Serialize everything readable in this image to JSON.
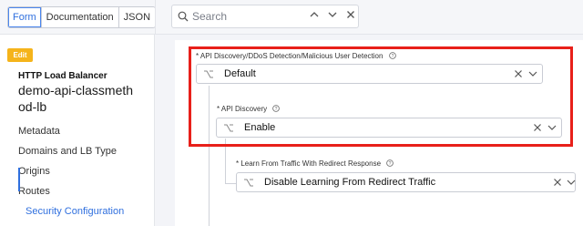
{
  "tabs": [
    {
      "label": "Form",
      "active": true
    },
    {
      "label": "Documentation",
      "active": false
    },
    {
      "label": "JSON",
      "active": false
    }
  ],
  "search": {
    "placeholder": "Search"
  },
  "left": {
    "badge": "Edit",
    "type": "HTTP Load Balancer",
    "name": "demo-api-classmeth od-lb",
    "nav": [
      {
        "label": "Metadata",
        "active": false
      },
      {
        "label": "Domains and LB Type",
        "active": false
      },
      {
        "label": "Origins",
        "active": false
      },
      {
        "label": "Routes",
        "active": false
      },
      {
        "label": "Security Configuration",
        "active": true
      }
    ]
  },
  "fields": [
    {
      "label": "* API Discovery/DDoS Detection/Malicious User Detection",
      "value": "Default"
    },
    {
      "label": "* API Discovery",
      "value": "Enable"
    },
    {
      "label": "* Learn From Traffic With Redirect Response",
      "value": "Disable Learning From Redirect Traffic"
    }
  ],
  "icons": {
    "search": "search-icon",
    "up": "chevron-up-icon",
    "down": "chevron-down-icon",
    "close": "close-icon",
    "help": "help-circle-icon",
    "option": "option-icon"
  },
  "colors": {
    "accent": "#2f6fde",
    "highlight": "#e8201a",
    "badge": "#f5b41b"
  }
}
